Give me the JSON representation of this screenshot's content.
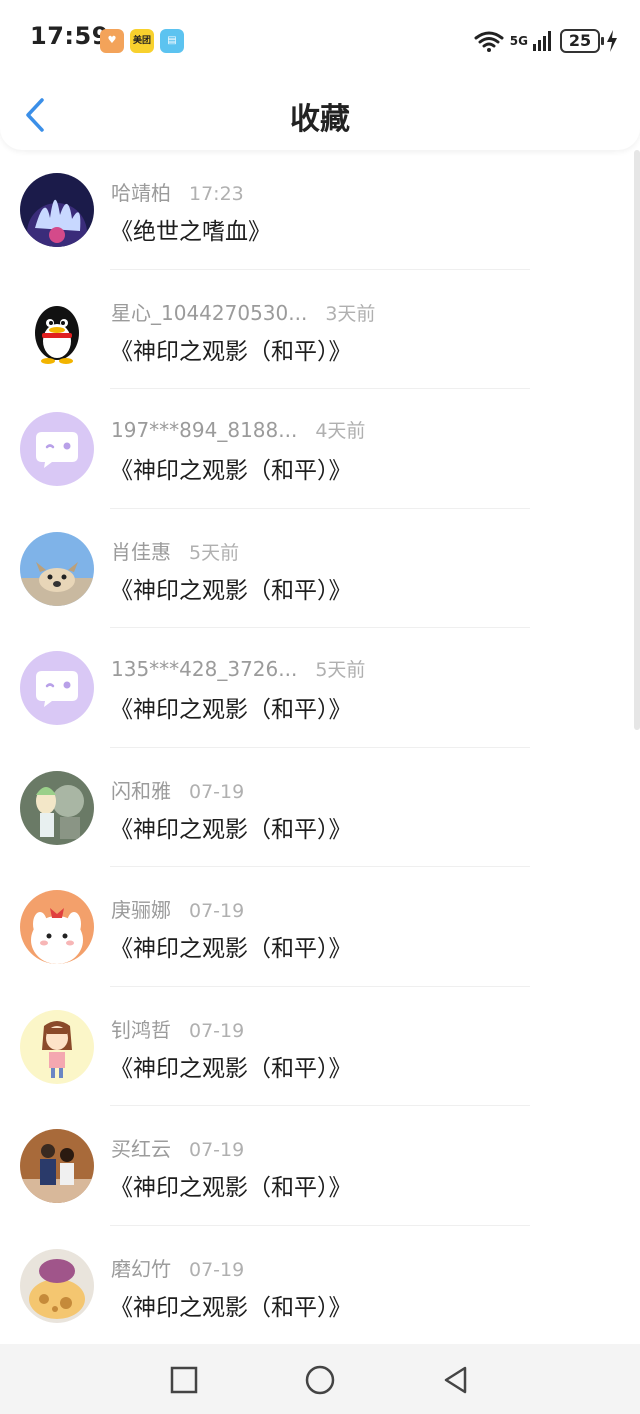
{
  "status": {
    "time": "17:59",
    "network": "5G",
    "battery": "25",
    "app_badges": [
      "heart-app-icon",
      "meituan-app-icon",
      "book-app-icon"
    ],
    "meituan_label": "美团"
  },
  "header": {
    "title": "收藏"
  },
  "items": [
    {
      "name": "哈靖柏",
      "when": "17:23",
      "title": "《绝世之嗜血》",
      "avatar": "coral-photo-avatar"
    },
    {
      "name": "星心_1044270530...",
      "when": "3天前",
      "title": "《神印之观影（和平）》",
      "avatar": "penguin-avatar"
    },
    {
      "name": "197***894_8188...",
      "when": "4天前",
      "title": "《神印之观影（和平）》",
      "avatar": "chat-bubble-avatar"
    },
    {
      "name": "肖佳惠",
      "when": "5天前",
      "title": "《神印之观影（和平）》",
      "avatar": "dog-sky-avatar"
    },
    {
      "name": "135***428_3726...",
      "when": "5天前",
      "title": "《神印之观影（和平）》",
      "avatar": "chat-bubble-avatar"
    },
    {
      "name": "闪和雅",
      "when": "07-19",
      "title": "《神印之观影（和平）》",
      "avatar": "anime-character-avatar"
    },
    {
      "name": "庚骊娜",
      "when": "07-19",
      "title": "《神印之观影（和平）》",
      "avatar": "cartoon-bunny-avatar"
    },
    {
      "name": "钊鸿哲",
      "when": "07-19",
      "title": "《神印之观影（和平）》",
      "avatar": "cartoon-girl-avatar"
    },
    {
      "name": "买红云",
      "when": "07-19",
      "title": "《神印之观影（和平）》",
      "avatar": "couple-photo-avatar"
    },
    {
      "name": "磨幻竹",
      "when": "07-19",
      "title": "《神印之观影（和平）》",
      "avatar": "cake-photo-avatar"
    }
  ],
  "colors": {
    "accent": "#3b8fe8",
    "chat_bubble_bg": "#d9c8f5",
    "chat_bubble": "#ffffff"
  }
}
